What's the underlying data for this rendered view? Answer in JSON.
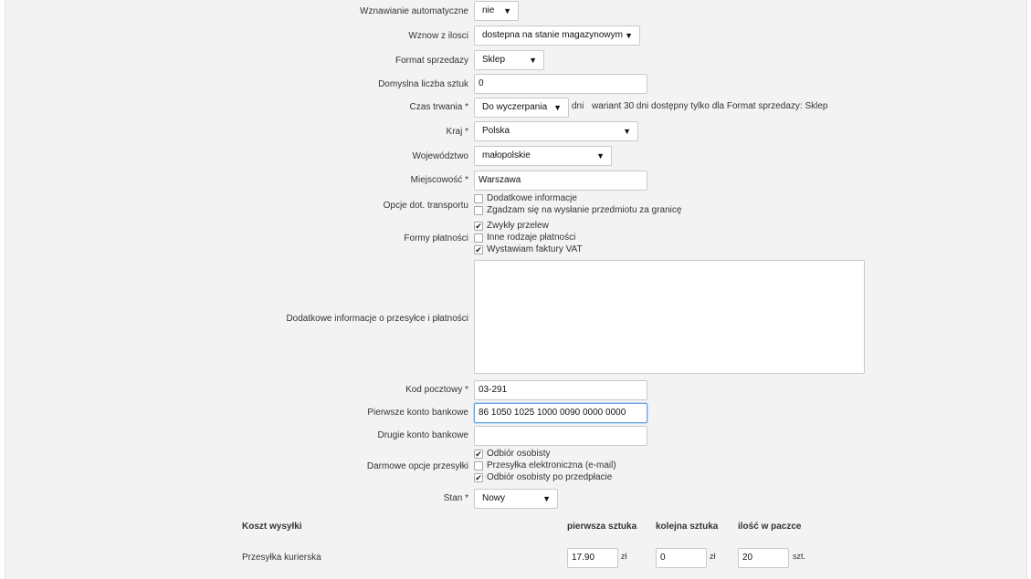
{
  "form": {
    "wznawianie": {
      "label": "Wznawianie automatyczne",
      "value": "nie"
    },
    "wznow": {
      "label": "Wznow z ilosci",
      "value": "dostepna na stanie magazynowym"
    },
    "format": {
      "label": "Format sprzedazy",
      "value": "Sklep"
    },
    "liczba": {
      "label": "Domyslna liczba sztuk",
      "value": "0"
    },
    "czas": {
      "label": "Czas trwania *",
      "value": "Do wyczerpania",
      "unit": "dni",
      "note": "wariant 30 dni dostępny tylko dla Format sprzedazy: Sklep"
    },
    "kraj": {
      "label": "Kraj *",
      "value": "Polska"
    },
    "woj": {
      "label": "Województwo",
      "value": "małopolskie"
    },
    "miasto": {
      "label": "Miejscowość *",
      "value": "Warszawa"
    },
    "transport": {
      "label": "Opcje dot. transportu",
      "options": [
        {
          "label": "Dodatkowe informacje",
          "checked": false
        },
        {
          "label": "Zgadzam się na wysłanie przedmiotu za granicę",
          "checked": false
        }
      ]
    },
    "platnosci": {
      "label": "Formy płatności",
      "options": [
        {
          "label": "Zwykły przelew",
          "checked": true
        },
        {
          "label": "Inne rodzaje płatności",
          "checked": false
        },
        {
          "label": "Wystawiam faktury VAT",
          "checked": true
        }
      ]
    },
    "dodatkowe": {
      "label": "Dodatkowe informacje o przesyłce i płatności",
      "value": ""
    },
    "kod": {
      "label": "Kod pocztowy *",
      "value": "03-291"
    },
    "konto1": {
      "label": "Pierwsze konto bankowe",
      "value": "86 1050 1025 1000 0090 0000 0000"
    },
    "konto2": {
      "label": "Drugie konto bankowe",
      "value": ""
    },
    "darmowe": {
      "label": "Darmowe opcje przesyłki",
      "options": [
        {
          "label": "Odbiór osobisty",
          "checked": true
        },
        {
          "label": "Przesyłka elektroniczna (e-mail)",
          "checked": false
        },
        {
          "label": "Odbiór osobisty po przedpłacie",
          "checked": true
        }
      ]
    },
    "stan": {
      "label": "Stan *",
      "value": "Nowy"
    }
  },
  "shipping": {
    "headers": {
      "name": "Koszt wysyłki",
      "first": "pierwsza sztuka",
      "next": "kolejna sztuka",
      "qty": "ilość w paczce"
    },
    "rows": [
      {
        "name": "Przesyłka kurierska",
        "first": "17.90",
        "first_unit": "zł",
        "next": "0",
        "next_unit": "zł",
        "qty": "20",
        "qty_unit": "szt."
      }
    ]
  },
  "glyphs": {
    "arrow": "▼",
    "check": "✔"
  }
}
